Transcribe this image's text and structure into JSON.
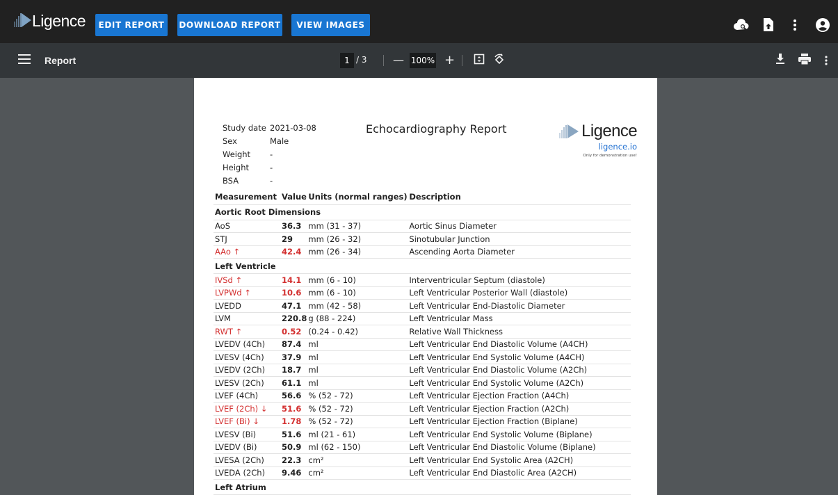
{
  "app": {
    "brand": "Ligence",
    "buttons": {
      "edit": "EDIT REPORT",
      "download": "DOWNLOAD REPORT",
      "view_images": "VIEW IMAGES"
    },
    "icons": [
      "cloud-search-icon",
      "file-upload-icon",
      "more-vert-icon",
      "account-icon"
    ],
    "accent": "#1976d2"
  },
  "viewer": {
    "title": "Report",
    "page_current": "1",
    "page_total": "/ 3",
    "zoom": "100%"
  },
  "report": {
    "info": [
      {
        "label": "Study date",
        "value": "2021-03-08"
      },
      {
        "label": "Sex",
        "value": "Male"
      },
      {
        "label": "Weight",
        "value": "-"
      },
      {
        "label": "Height",
        "value": "-"
      },
      {
        "label": "BSA",
        "value": "-"
      }
    ],
    "title": "Echocardiography Report",
    "logo": {
      "text": "Ligence",
      "link": "ligence.io",
      "note": "Only for demonstration use!"
    },
    "headers": {
      "measurement": "Measurement",
      "value": "Value",
      "units": "Units (normal ranges)",
      "description": "Description"
    },
    "sections": [
      {
        "title": "Aortic Root Dimensions",
        "rows": [
          {
            "name": "AoS",
            "value": "36.3",
            "units": "mm (31 - 37)",
            "desc": "Aortic Sinus Diameter",
            "abnormal": false
          },
          {
            "name": "STJ",
            "value": "29",
            "units": "mm (26 - 32)",
            "desc": "Sinotubular Junction",
            "abnormal": false
          },
          {
            "name": "AAo ↑",
            "value": "42.4",
            "units": "mm (26 - 34)",
            "desc": "Ascending Aorta Diameter",
            "abnormal": true
          }
        ]
      },
      {
        "title": "Left Ventricle",
        "rows": [
          {
            "name": "IVSd ↑",
            "value": "14.1",
            "units": "mm (6 - 10)",
            "desc": "Interventricular Septum (diastole)",
            "abnormal": true
          },
          {
            "name": "LVPWd ↑",
            "value": "10.6",
            "units": "mm (6 - 10)",
            "desc": "Left Ventricular Posterior Wall (diastole)",
            "abnormal": true
          },
          {
            "name": "LVEDD",
            "value": "47.1",
            "units": "mm (42 - 58)",
            "desc": "Left Ventricular End-Diastolic Diameter",
            "abnormal": false
          },
          {
            "name": "LVM",
            "value": "220.8",
            "units": "g (88 - 224)",
            "desc": "Left Ventricular Mass",
            "abnormal": false
          },
          {
            "name": "RWT ↑",
            "value": "0.52",
            "units": "(0.24 - 0.42)",
            "desc": "Relative Wall Thickness",
            "abnormal": true
          },
          {
            "name": "LVEDV (4Ch)",
            "value": "87.4",
            "units": "ml",
            "desc": "Left Ventricular End Diastolic Volume (A4CH)",
            "abnormal": false
          },
          {
            "name": "LVESV (4Ch)",
            "value": "37.9",
            "units": "ml",
            "desc": "Left Ventricular End Systolic Volume (A4CH)",
            "abnormal": false
          },
          {
            "name": "LVEDV (2Ch)",
            "value": "18.7",
            "units": "ml",
            "desc": "Left Ventricular End Diastolic Volume (A2Ch)",
            "abnormal": false
          },
          {
            "name": "LVESV (2Ch)",
            "value": "61.1",
            "units": "ml",
            "desc": "Left Ventricular End Systolic Volume (A2Ch)",
            "abnormal": false
          },
          {
            "name": "LVEF (4Ch)",
            "value": "56.6",
            "units": "% (52 - 72)",
            "desc": "Left Ventricular Ejection Fraction (A4Ch)",
            "abnormal": false
          },
          {
            "name": "LVEF (2Ch) ↓",
            "value": "51.6",
            "units": "% (52 - 72)",
            "desc": "Left Ventricular Ejection Fraction (A2Ch)",
            "abnormal": true
          },
          {
            "name": "LVEF (Bi) ↓",
            "value": "1.78",
            "units": "% (52 - 72)",
            "desc": "Left Ventricular Ejection Fraction (Biplane)",
            "abnormal": true
          },
          {
            "name": "LVESV (Bi)",
            "value": "51.6",
            "units": "ml (21 - 61)",
            "desc": "Left Ventricular End Systolic Volume (Biplane)",
            "abnormal": false
          },
          {
            "name": "LVEDV (Bi)",
            "value": "50.9",
            "units": "ml (62 - 150)",
            "desc": "Left Ventricular End Diastolic Volume (Biplane)",
            "abnormal": false
          },
          {
            "name": "LVESA (2Ch)",
            "value": "22.3",
            "units": "cm²",
            "desc": "Left Ventricular End Systolic Area (A2CH)",
            "abnormal": false
          },
          {
            "name": "LVEDA (2Ch)",
            "value": "9.46",
            "units": "cm²",
            "desc": "Left Ventricular End Diastolic Area (A2CH)",
            "abnormal": false
          }
        ]
      },
      {
        "title": "Left Atrium",
        "rows": []
      }
    ]
  }
}
